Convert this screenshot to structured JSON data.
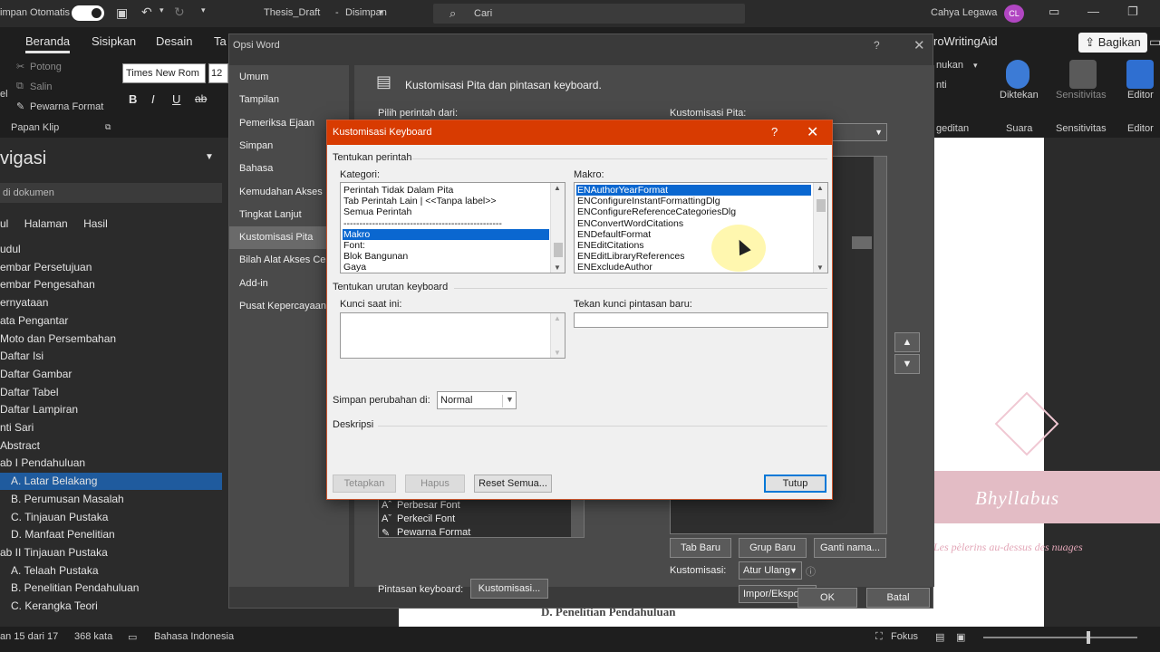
{
  "titlebar": {
    "autosave_label": "impan Otomatis",
    "doc_title": "Thesis_Draft",
    "status": "Disimpan",
    "search_placeholder": "Cari",
    "user_name": "Cahya Legawa",
    "user_initials": "CL"
  },
  "ribbon": {
    "tabs": [
      "Beranda",
      "Sisipkan",
      "Desain",
      "Ta",
      "roWritingAid"
    ],
    "share_label": "Bagikan",
    "clipboard": {
      "cut": "Potong",
      "copy": "Salin",
      "paste_partial": "el",
      "format_painter": "Pewarna Format",
      "group_label": "Papan Klip"
    },
    "font_name": "Times New Rom",
    "font_size": "12",
    "format_buttons": [
      "B",
      "I",
      "U",
      "ab"
    ],
    "right": {
      "find": "nukan",
      "replace": "nti",
      "editing_group": "geditan",
      "dictate": "Diktekan",
      "voice_group": "Suara",
      "sensitivity": "Sensitivitas",
      "sensitivity_group": "Sensitivitas",
      "editor": "Editor",
      "editor_group": "Editor"
    }
  },
  "nav": {
    "title": "vigasi",
    "search_placeholder": "di dokumen",
    "tabs": [
      "ul",
      "Halaman",
      "Hasil"
    ],
    "items": [
      {
        "label": "udul",
        "indent": 0
      },
      {
        "label": "embar Persetujuan",
        "indent": 0
      },
      {
        "label": "embar Pengesahan",
        "indent": 0
      },
      {
        "label": "ernyataan",
        "indent": 0
      },
      {
        "label": "ata Pengantar",
        "indent": 0
      },
      {
        "label": "Moto dan Persembahan",
        "indent": 0
      },
      {
        "label": "Daftar Isi",
        "indent": 0
      },
      {
        "label": "Daftar Gambar",
        "indent": 0
      },
      {
        "label": "Daftar Tabel",
        "indent": 0
      },
      {
        "label": "Daftar Lampiran",
        "indent": 0
      },
      {
        "label": "nti Sari",
        "indent": 0
      },
      {
        "label": "Abstract",
        "indent": 0
      },
      {
        "label": "ab I Pendahuluan",
        "indent": 0
      },
      {
        "label": "A. Latar Belakang",
        "indent": 1
      },
      {
        "label": "B. Perumusan Masalah",
        "indent": 1
      },
      {
        "label": "C. Tinjauan Pustaka",
        "indent": 1
      },
      {
        "label": "D. Manfaat Penelitian",
        "indent": 1
      },
      {
        "label": "ab II Tinjauan Pustaka",
        "indent": 0
      },
      {
        "label": "A. Telaah Pustaka",
        "indent": 1
      },
      {
        "label": "B. Penelitian Pendahuluan",
        "indent": 1
      },
      {
        "label": "C. Kerangka Teori",
        "indent": 1
      }
    ],
    "selected_index": 13
  },
  "document": {
    "watermark_title": "Bhyllabus",
    "watermark_sub": "Les pèlerins au-dessus des nuages",
    "visible_text": "D. Penelitian Pendahuluan"
  },
  "statusbar": {
    "page": "an 15 dari 17",
    "words": "368 kata",
    "language": "Bahasa Indonesia",
    "focus": "Fokus"
  },
  "opsi": {
    "title": "Opsi Word",
    "help": "?",
    "close": "✕",
    "categories": [
      "Umum",
      "Tampilan",
      "Pemeriksa Ejaan",
      "Simpan",
      "Bahasa",
      "Kemudahan Akses",
      "Tingkat Lanjut",
      "Kustomisasi Pita",
      "Bilah Alat Akses Cepat",
      "Add-in",
      "Pusat Kepercayaan"
    ],
    "selected_category": 7,
    "heading": "Kustomisasi Pita dan pintasan keyboard.",
    "choose_commands": "Pilih perintah dari:",
    "customize_ribbon": "Kustomisasi Pita:",
    "list_items": [
      {
        "label": "Perbesar Font",
        "icon": "A+"
      },
      {
        "label": "Perkecil Font",
        "icon": "A-"
      },
      {
        "label": "Pewarna Format",
        "icon": "brush"
      }
    ],
    "keyboard_shortcuts_label": "Pintasan keyboard:",
    "customize_button": "Kustomisasi...",
    "new_tab": "Tab Baru",
    "new_group": "Grup Baru",
    "rename": "Ganti nama...",
    "customizations_label": "Kustomisasi:",
    "reset": "Atur Ulang",
    "import_export": "Impor/Ekspor",
    "ok": "OK",
    "cancel": "Batal"
  },
  "keyboard_dialog": {
    "title": "Kustomisasi Keyboard",
    "help": "?",
    "close": "✕",
    "specify_command": "Tentukan perintah",
    "categories_label": "Kategori:",
    "categories": [
      "Perintah Tidak Dalam Pita",
      "Tab Perintah Lain | <<Tanpa label>>",
      "Semua Perintah",
      "--------------------------------------------------",
      "Makro",
      "Font:",
      "Blok Bangunan",
      "Gaya"
    ],
    "selected_category": 4,
    "macros_label": "Makro:",
    "macros": [
      "ENAuthorYearFormat",
      "ENConfigureInstantFormattingDlg",
      "ENConfigureReferenceCategoriesDlg",
      "ENConvertWordCitations",
      "ENDefaultFormat",
      "ENEditCitations",
      "ENEditLibraryReferences",
      "ENExcludeAuthor"
    ],
    "selected_macro": 0,
    "specify_sequence": "Tentukan urutan keyboard",
    "current_keys": "Kunci saat ini:",
    "press_new": "Tekan kunci pintasan baru:",
    "save_in_label": "Simpan perubahan di:",
    "save_in_value": "Normal",
    "description_label": "Deskripsi",
    "assign": "Tetapkan",
    "remove": "Hapus",
    "reset_all": "Reset Semua...",
    "close_button": "Tutup"
  }
}
